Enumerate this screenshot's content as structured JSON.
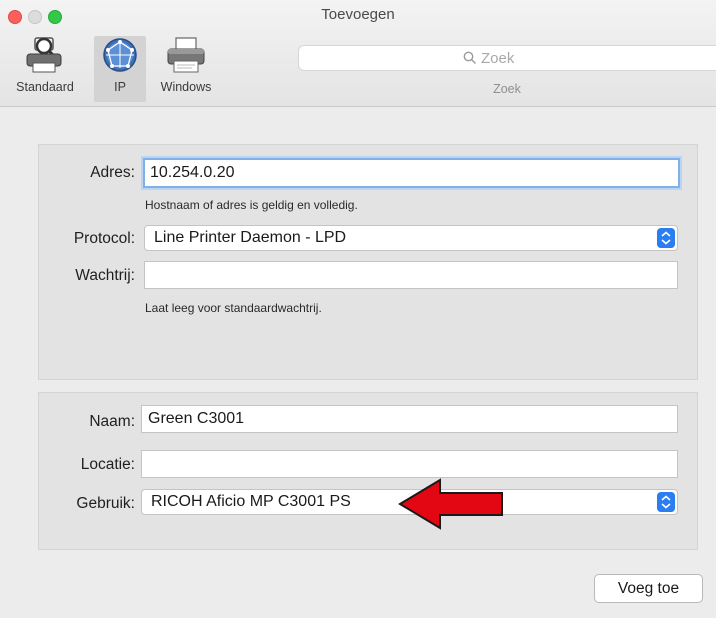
{
  "window": {
    "title": "Toevoegen"
  },
  "toolbar": {
    "tools": [
      {
        "label": "Standaard",
        "icon": "printer-search-icon",
        "selected": false
      },
      {
        "label": "IP",
        "icon": "globe-network-icon",
        "selected": true
      },
      {
        "label": "Windows",
        "icon": "printer-icon",
        "selected": false
      }
    ],
    "search": {
      "placeholder": "Zoek",
      "value": "",
      "caption": "Zoek"
    }
  },
  "connection": {
    "address_label": "Adres:",
    "address_value": "10.254.0.20",
    "address_hint": "Hostnaam of adres is geldig en volledig.",
    "protocol_label": "Protocol:",
    "protocol_value": "Line Printer Daemon - LPD",
    "queue_label": "Wachtrij:",
    "queue_value": "",
    "queue_hint": "Laat leeg voor standaardwachtrij."
  },
  "printer": {
    "name_label": "Naam:",
    "name_value": "Green C3001",
    "location_label": "Locatie:",
    "location_value": "",
    "use_label": "Gebruik:",
    "use_value": "RICOH Aficio MP C3001 PS"
  },
  "actions": {
    "add_label": "Voeg toe"
  },
  "colors": {
    "focus_ring": "#7fb0e8",
    "popup_stepper": "#1b73e8",
    "annotation_arrow": "#e30613"
  }
}
